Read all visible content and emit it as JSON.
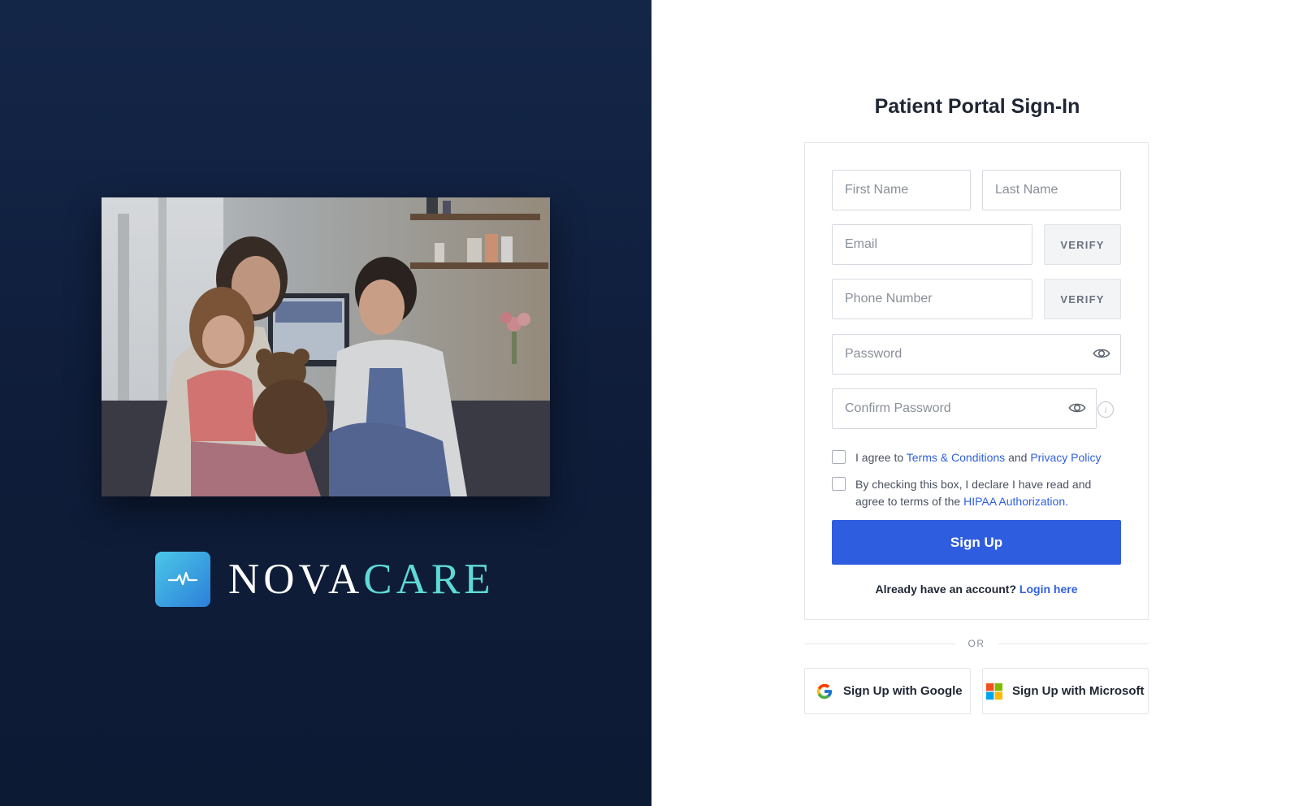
{
  "brand": {
    "name_part1": "NOVA",
    "name_part2": "CARE",
    "mark_icon": "heartbeat-icon",
    "colors": {
      "part1": "#ffffff",
      "part2": "#5fd9d6",
      "mark_from": "#4bc7e8",
      "mark_to": "#2c7fd9"
    }
  },
  "hero_image": {
    "icon": "photo-icon"
  },
  "form": {
    "title": "Patient Portal Sign-In",
    "first_name_placeholder": "First Name",
    "last_name_placeholder": "Last Name",
    "email_placeholder": "Email",
    "email_verify_label": "VERIFY",
    "phone_placeholder": "Phone Number",
    "phone_verify_label": "VERIFY",
    "password_placeholder": "Password",
    "confirm_password_placeholder": "Confirm Password",
    "terms": {
      "prefix": "I agree to",
      "terms_link": "Terms & Conditions",
      "conjunction": "and",
      "privacy_link": "Privacy Policy",
      "checked": false
    },
    "hipaa": {
      "text": "By checking this box, I declare I have read and agree to terms of the",
      "link": "HIPAA Authorization",
      "suffix": ".",
      "checked": false
    },
    "signup_label": "Sign Up",
    "have_account_text": "Already have an account?",
    "login_link": "Login here"
  },
  "divider": {
    "label": "OR"
  },
  "social": {
    "google_label": "Sign Up with Google",
    "microsoft_label": "Sign Up with Microsoft"
  },
  "colors": {
    "accent": "#2f5ddf",
    "link": "#2f60e0",
    "left_bg": "#0f1d3a"
  }
}
